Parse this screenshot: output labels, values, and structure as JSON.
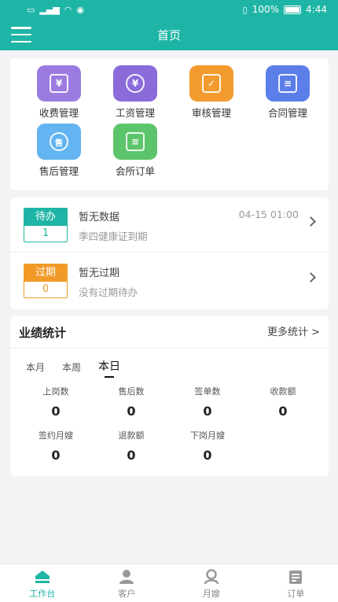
{
  "status_bar": {
    "battery": "100%",
    "time": "4:44"
  },
  "header": {
    "title": "首页"
  },
  "menu": {
    "items": [
      {
        "label": "收费管理",
        "icon": "fee-management-icon",
        "color": "#9b7be0",
        "glyph": "¥"
      },
      {
        "label": "工资管理",
        "icon": "salary-management-icon",
        "color": "#8a6bd9",
        "glyph": "¥"
      },
      {
        "label": "审核管理",
        "icon": "review-management-icon",
        "color": "#f39a2e",
        "glyph": "✓"
      },
      {
        "label": "合同管理",
        "icon": "contract-management-icon",
        "color": "#5b7ee8",
        "glyph": "≡"
      },
      {
        "label": "售后管理",
        "icon": "after-sales-icon",
        "color": "#63b4f0",
        "glyph": "售"
      },
      {
        "label": "会所订单",
        "icon": "club-order-icon",
        "color": "#5cc56b",
        "glyph": "≡"
      }
    ]
  },
  "todo": {
    "pending": {
      "tag": "待办",
      "count": "1",
      "title": "暂无数据",
      "subtitle": "李四健康证到期",
      "time": "04-15 01:00"
    },
    "expired": {
      "tag": "过期",
      "count": "0",
      "title": "暂无过期",
      "subtitle": "没有过期待办"
    }
  },
  "stats": {
    "title": "业绩统计",
    "more": "更多统计 >",
    "periods": [
      "本月",
      "本周",
      "本日"
    ],
    "active_period": "本日",
    "items": [
      {
        "label": "上岗数",
        "value": "0"
      },
      {
        "label": "售后数",
        "value": "0"
      },
      {
        "label": "签单数",
        "value": "0"
      },
      {
        "label": "收款额",
        "value": "0"
      },
      {
        "label": "签约月嫂",
        "value": "0"
      },
      {
        "label": "退款额",
        "value": "0"
      },
      {
        "label": "下岗月嫂",
        "value": "0"
      }
    ]
  },
  "tabbar": {
    "items": [
      {
        "label": "工作台",
        "icon": "workbench-icon",
        "active": true
      },
      {
        "label": "客户",
        "icon": "customer-icon",
        "active": false
      },
      {
        "label": "月嫂",
        "icon": "nanny-icon",
        "active": false
      },
      {
        "label": "订单",
        "icon": "order-icon",
        "active": false
      }
    ]
  },
  "colors": {
    "primary": "#1fb5a6",
    "warning": "#f29a28"
  }
}
